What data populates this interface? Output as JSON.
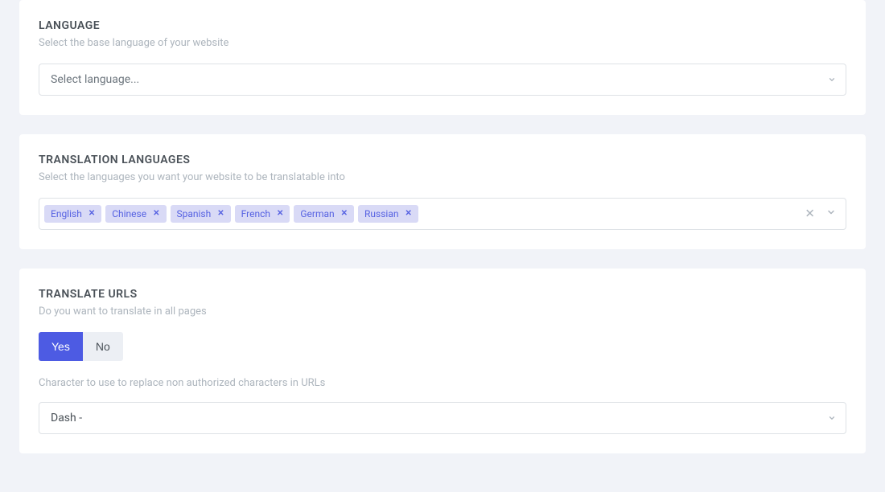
{
  "language": {
    "title": "LANGUAGE",
    "subtitle": "Select the base language of your website",
    "placeholder": "Select language..."
  },
  "translation": {
    "title": "TRANSLATION LANGUAGES",
    "subtitle": "Select the languages you want your website to be translatable into",
    "tags": [
      "English",
      "Chinese",
      "Spanish",
      "French",
      "German",
      "Russian"
    ]
  },
  "urls": {
    "title": "TRANSLATE URLS",
    "subtitle": "Do you want to translate in all pages",
    "yes": "Yes",
    "no": "No",
    "helper": "Character to use to replace non authorized characters in URLs",
    "separator_value": "Dash -"
  }
}
